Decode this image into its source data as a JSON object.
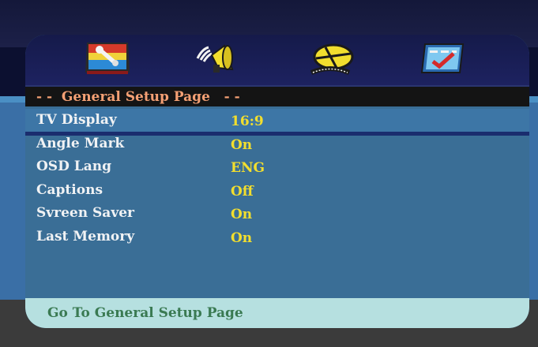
{
  "tabs": [
    {
      "icon": "general-setup-icon"
    },
    {
      "icon": "audio-setup-icon"
    },
    {
      "icon": "video-setup-icon"
    },
    {
      "icon": "preference-icon"
    }
  ],
  "page_header": "- -  General Setup Page   - -",
  "items": [
    {
      "label": "TV Display",
      "value": "16:9"
    },
    {
      "label": "Angle Mark",
      "value": "On"
    },
    {
      "label": "OSD Lang",
      "value": "ENG"
    },
    {
      "label": "Captions",
      "value": "Off"
    },
    {
      "label": "Svreen Saver",
      "value": "On"
    },
    {
      "label": "Last Memory",
      "value": "On"
    }
  ],
  "help_text": "Go To General Setup Page",
  "colors": {
    "header_text": "#f4a074",
    "label_text": "#f0f2f4",
    "value_text": "#f2de2e",
    "help_text": "#3a7a52",
    "help_bar": "#b6e0e0",
    "panel": "#3a6e96"
  }
}
